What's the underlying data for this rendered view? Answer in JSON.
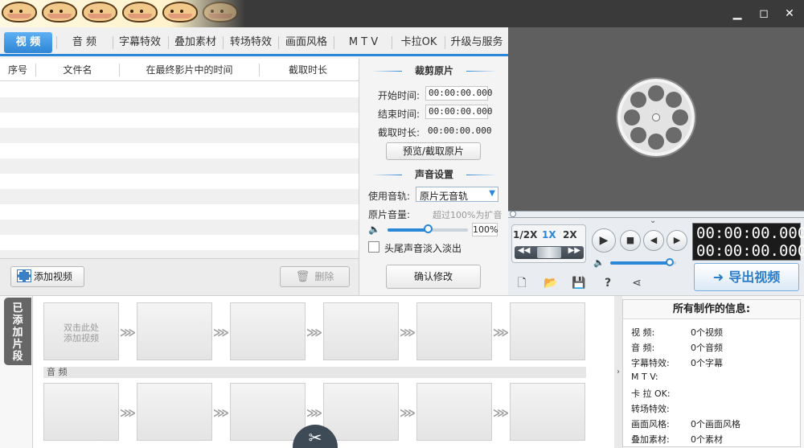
{
  "window": {
    "minimize_glyph": "▁",
    "maximize_glyph": "◻",
    "close_glyph": "✕"
  },
  "tabs": [
    {
      "label": "视 频",
      "active": true
    },
    {
      "label": "音 频"
    },
    {
      "label": "字幕特效"
    },
    {
      "label": "叠加素材"
    },
    {
      "label": "转场特效"
    },
    {
      "label": "画面风格"
    },
    {
      "label": "M T V"
    },
    {
      "label": "卡拉OK"
    },
    {
      "label": "升级与服务"
    }
  ],
  "file_list": {
    "columns": [
      "序号",
      "文件名",
      "在最终影片中的时间",
      "截取时长"
    ],
    "rows": []
  },
  "left_footer": {
    "add_video": "添加视频",
    "delete": "删除"
  },
  "clip_panel": {
    "title": "裁剪原片",
    "start_label": "开始时间:",
    "start_value": "00:00:00.000",
    "end_label": "结束时间:",
    "end_value": "00:00:00.000",
    "duration_label": "截取时长:",
    "duration_value": "00:00:00.000",
    "preview_button": "预览/截取原片",
    "audio_title": "声音设置",
    "track_label": "使用音轨:",
    "track_value": "原片无音轨",
    "volume_label": "原片音量:",
    "volume_hint": "超过100%为扩音",
    "volume_value": "100%",
    "volume_level": 0.5,
    "fade_label": "头尾声音淡入淡出",
    "confirm_button": "确认修改"
  },
  "player": {
    "speed_half": "1/2X",
    "speed_1x": "1X",
    "speed_2x": "2X",
    "time_current": "00:00:00.000",
    "time_total": "00:00:00.000",
    "volume_level": 0.9,
    "export_button": "导出视频"
  },
  "timeline": {
    "side_tab": "已添加片段",
    "first_slot_text": "双击此处\n添加视频",
    "audio_label": "音 频"
  },
  "info": {
    "title": "所有制作的信息:",
    "rows": [
      {
        "k": "视    频:",
        "v": "0个视频"
      },
      {
        "k": "音    频:",
        "v": "0个音频"
      },
      {
        "k": "字幕特效:",
        "v": "0个字幕"
      },
      {
        "k": "M  T  V:",
        "v": ""
      },
      {
        "k": "卡 拉 OK:",
        "v": ""
      },
      {
        "k": "转场特效:",
        "v": ""
      },
      {
        "k": "画面风格:",
        "v": "0个画面风格"
      },
      {
        "k": "叠加素材:",
        "v": "0个素材"
      }
    ]
  },
  "colors": {
    "accent": "#2b87d8",
    "dark_bg": "#3a3a3a",
    "preview_bg": "#5f5f5f"
  }
}
